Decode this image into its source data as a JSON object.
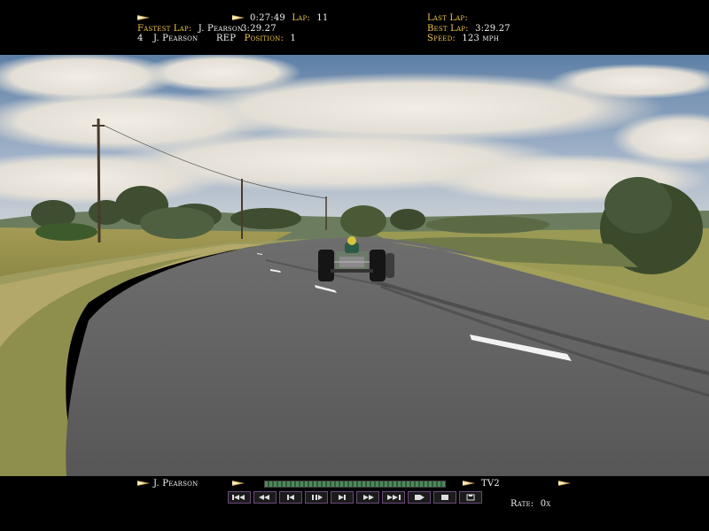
{
  "hud": {
    "fastest_lap_label": "Fastest Lap:",
    "fastest_lap_driver": "J. Pearson",
    "session_time": "0:27:49",
    "lap_label": "Lap:",
    "lap_value": "11",
    "fastest_lap_time": "3:29.27",
    "position_number": "4",
    "driver_name": "J. Pearson",
    "rep": "REP",
    "position_label": "Position:",
    "position_value": "1",
    "last_lap_label": "Last Lap:",
    "best_lap_label": "Best Lap:",
    "best_lap_value": "3:29.27",
    "speed_label": "Speed:",
    "speed_value": "123 mph"
  },
  "replay": {
    "driver": "J. Pearson",
    "camera": "TV2",
    "rate_label": "Rate:",
    "rate_value": "0x",
    "progress": 1.0,
    "controls": [
      "rewind-to-start",
      "fast-rewind",
      "step-back",
      "play-pause",
      "step-forward",
      "fast-forward",
      "forward-to-end",
      "record",
      "stop",
      "save"
    ]
  },
  "colors": {
    "label": "#f2c94c",
    "value": "#f2f2f2",
    "button_border": "#6a4a7a"
  }
}
